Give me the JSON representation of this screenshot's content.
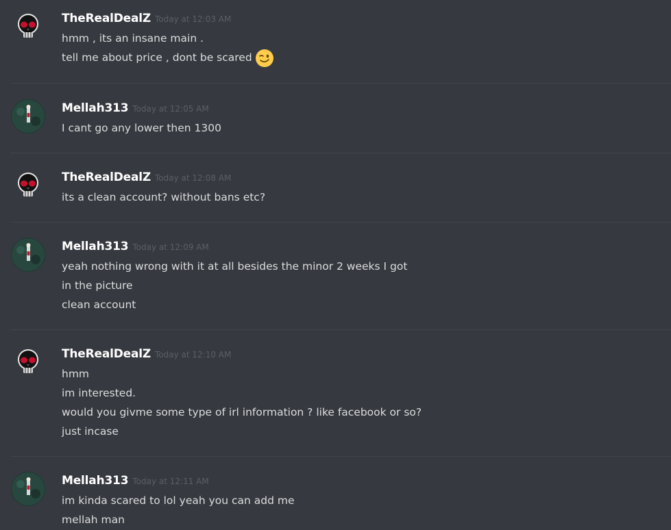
{
  "colors": {
    "background": "#36393f",
    "username": "#ffffff",
    "timestamp": "#5c5f66",
    "message": "#dcddde",
    "divider": "#42454b"
  },
  "messages": [
    {
      "author": "TheRealDealZ",
      "avatar_icon": "skull-avatar-icon",
      "timestamp": "Today at 12:03 AM",
      "lines": [
        "hmm , its an insane main .",
        "tell me about price , dont be scared"
      ],
      "emoji": "winking-face-emoji"
    },
    {
      "author": "Mellah313",
      "avatar_icon": "dark-green-portrait-avatar-icon",
      "timestamp": "Today at 12:05 AM",
      "lines": [
        "I cant go any lower then 1300"
      ]
    },
    {
      "author": "TheRealDealZ",
      "avatar_icon": "skull-avatar-icon",
      "timestamp": "Today at 12:08 AM",
      "lines": [
        "its a clean account? without bans etc?"
      ]
    },
    {
      "author": "Mellah313",
      "avatar_icon": "dark-green-portrait-avatar-icon",
      "timestamp": "Today at 12:09 AM",
      "lines": [
        "yeah nothing wrong with it at all besides the minor 2 weeks I got",
        "in the picture",
        "clean account"
      ]
    },
    {
      "author": "TheRealDealZ",
      "avatar_icon": "skull-avatar-icon",
      "timestamp": "Today at 12:10 AM",
      "lines": [
        "hmm",
        "im interested.",
        "would you givme some type of irl information ? like facebook or so?",
        "just incase"
      ]
    },
    {
      "author": "Mellah313",
      "avatar_icon": "dark-green-portrait-avatar-icon",
      "timestamp": "Today at 12:11 AM",
      "lines": [
        "im kinda scared to lol yeah you can add me",
        "mellah man"
      ]
    }
  ]
}
